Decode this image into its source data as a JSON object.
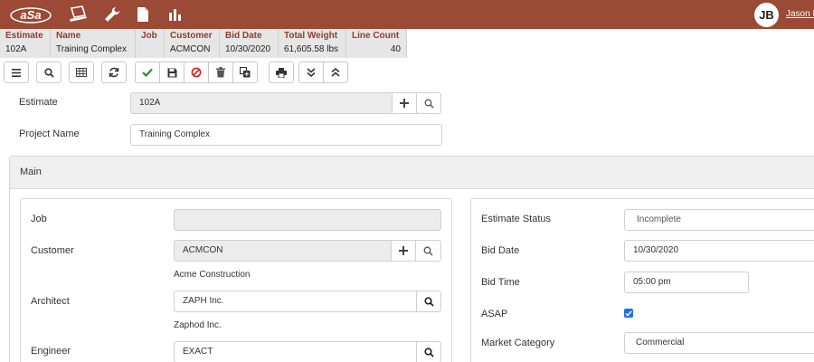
{
  "header": {
    "logo_text": "aSa",
    "nav_icons": [
      "laptop-icon",
      "wrench-icon",
      "document-icon",
      "bar-chart-icon"
    ],
    "user_initials": "JB",
    "user_name": "Jason B"
  },
  "summary": {
    "columns": [
      {
        "header": "Estimate",
        "value": "102A"
      },
      {
        "header": "Name",
        "value": "Training Complex"
      },
      {
        "header": "Job",
        "value": ""
      },
      {
        "header": "Customer",
        "value": "ACMCON"
      },
      {
        "header": "Bid Date",
        "value": "10/30/2020"
      },
      {
        "header": "Total Weight",
        "value": "61,605.58 lbs"
      },
      {
        "header": "Line Count",
        "value": "40"
      }
    ]
  },
  "toolbar": {
    "groups": [
      [
        "menu-icon"
      ],
      [
        "search-icon"
      ],
      [
        "grid-icon"
      ],
      [
        "refresh-icon"
      ],
      [
        "check-icon",
        "save-icon",
        "cancel-icon",
        "delete-icon",
        "copy-icon"
      ],
      [
        "print-icon"
      ],
      [
        "expand-all-icon",
        "collapse-all-icon"
      ]
    ]
  },
  "form": {
    "estimate_label": "Estimate",
    "estimate_value": "102A",
    "project_name_label": "Project Name",
    "project_name_value": "Training Complex"
  },
  "main": {
    "title": "Main",
    "left": {
      "job_label": "Job",
      "job_value": "",
      "customer_label": "Customer",
      "customer_value": "ACMCON",
      "customer_name": "Acme Construction",
      "architect_label": "Architect",
      "architect_value": "ZAPH Inc.",
      "architect_name": "Zaphod Inc.",
      "engineer_label": "Engineer",
      "engineer_value": "EXACT"
    },
    "right": {
      "status_label": "Estimate Status",
      "status_value": "Incomplete",
      "bid_date_label": "Bid Date",
      "bid_date_value": "10/30/2020",
      "bid_time_label": "Bid Time",
      "bid_time_value": "05:00 pm",
      "asap_label": "ASAP",
      "asap_checked": true,
      "market_label": "Market Category",
      "market_value": "Commercial"
    }
  },
  "colors": {
    "brand": "#9a4a35",
    "summary_header": "#8e3e2c",
    "check_green": "#2e8b2e",
    "cancel_red": "#cc2222",
    "checkbox_blue": "#1a73e8"
  }
}
